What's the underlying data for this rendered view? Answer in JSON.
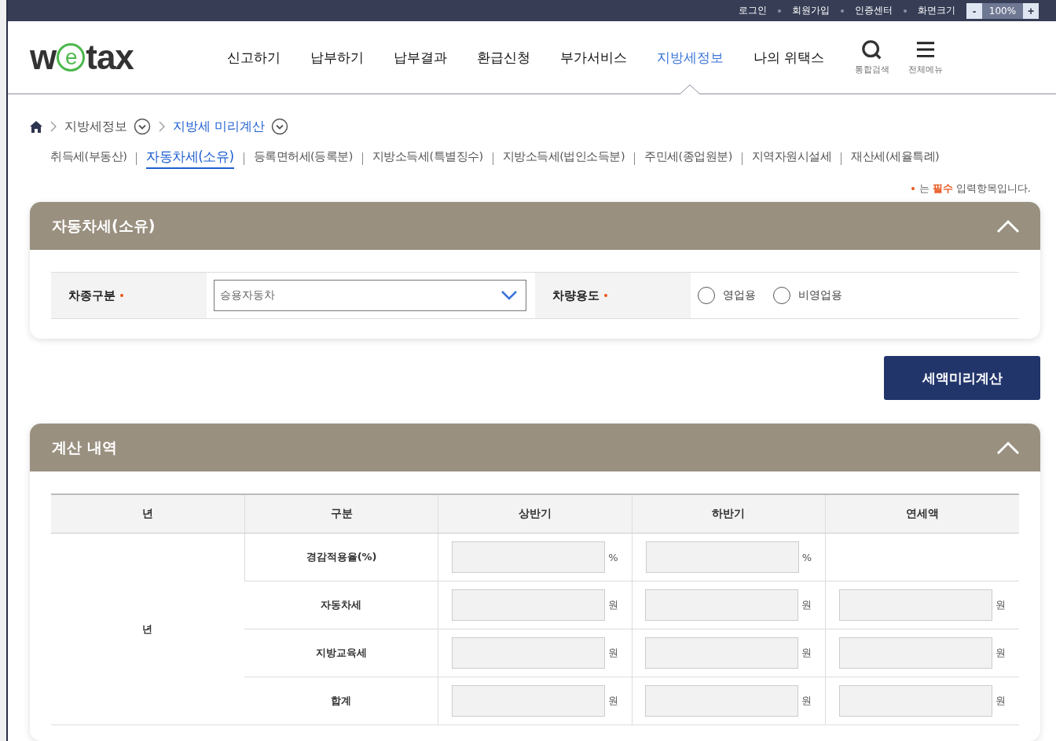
{
  "top_bar": {
    "links": [
      "로그인",
      "회원가입",
      "인증센터",
      "화면크기"
    ],
    "zoom": {
      "minus": "-",
      "value": "100%",
      "plus": "+"
    }
  },
  "header": {
    "logo": {
      "before": "w",
      "mark": "e",
      "after": "tax"
    },
    "nav": [
      {
        "label": "신고하기",
        "selected": false
      },
      {
        "label": "납부하기",
        "selected": false
      },
      {
        "label": "납부결과",
        "selected": false
      },
      {
        "label": "환급신청",
        "selected": false
      },
      {
        "label": "부가서비스",
        "selected": false
      },
      {
        "label": "지방세정보",
        "selected": true
      },
      {
        "label": "나의 위택스",
        "selected": false
      }
    ],
    "tools": [
      {
        "kind": "search",
        "label": "통합검색"
      },
      {
        "kind": "menu",
        "label": "전체메뉴"
      }
    ]
  },
  "breadcrumb": [
    {
      "label": "지방세정보",
      "selected": false
    },
    {
      "label": "지방세 미리계산",
      "selected": true
    }
  ],
  "tabs": [
    {
      "label": "취득세(부동산)",
      "selected": false
    },
    {
      "label": "자동차세(소유)",
      "selected": true
    },
    {
      "label": "등록면허세(등록분)",
      "selected": false
    },
    {
      "label": "지방소득세(특별징수)",
      "selected": false
    },
    {
      "label": "지방소득세(법인소득분)",
      "selected": false
    },
    {
      "label": "주민세(종업원분)",
      "selected": false
    },
    {
      "label": "지역자원시설세",
      "selected": false
    },
    {
      "label": "재산세(세율특례)",
      "selected": false
    }
  ],
  "required_note": {
    "before": "는",
    "emphasis": "필수",
    "after": "입력항목입니다."
  },
  "form_panel": {
    "title": "자동차세(소유)",
    "expanded": true,
    "fields": [
      {
        "label": "차종구분",
        "required": true,
        "kind": "select",
        "value": "승용자동차"
      },
      {
        "label": "차량용도",
        "required": true,
        "kind": "radio",
        "options": [
          {
            "label": "영업용",
            "selected": false
          },
          {
            "label": "비영업용",
            "selected": false
          }
        ]
      }
    ]
  },
  "calculate_button": "세액미리계산",
  "result_panel": {
    "title": "계산 내역",
    "expanded": true,
    "columns": [
      "년",
      "구분",
      "상반기",
      "하반기",
      "연세액"
    ],
    "rows": [
      {
        "cells": [
          {
            "text": "년",
            "rowspan": 4
          },
          {
            "text": "경감적용율(%)"
          },
          {
            "suffix": "%"
          },
          {
            "suffix": "%"
          },
          ""
        ]
      },
      {
        "cells": [
          {
            "text": "자동차세"
          },
          {
            "suffix": "원"
          },
          {
            "suffix": "원"
          },
          {
            "suffix": "원"
          }
        ]
      },
      {
        "cells": [
          {
            "text": "지방교육세"
          },
          {
            "suffix": "원"
          },
          {
            "suffix": "원"
          },
          {
            "suffix": "원"
          }
        ]
      },
      {
        "cells": [
          {
            "text": "합계"
          },
          {
            "suffix": "원"
          },
          {
            "suffix": "원"
          },
          {
            "suffix": "원"
          }
        ]
      }
    ]
  }
}
